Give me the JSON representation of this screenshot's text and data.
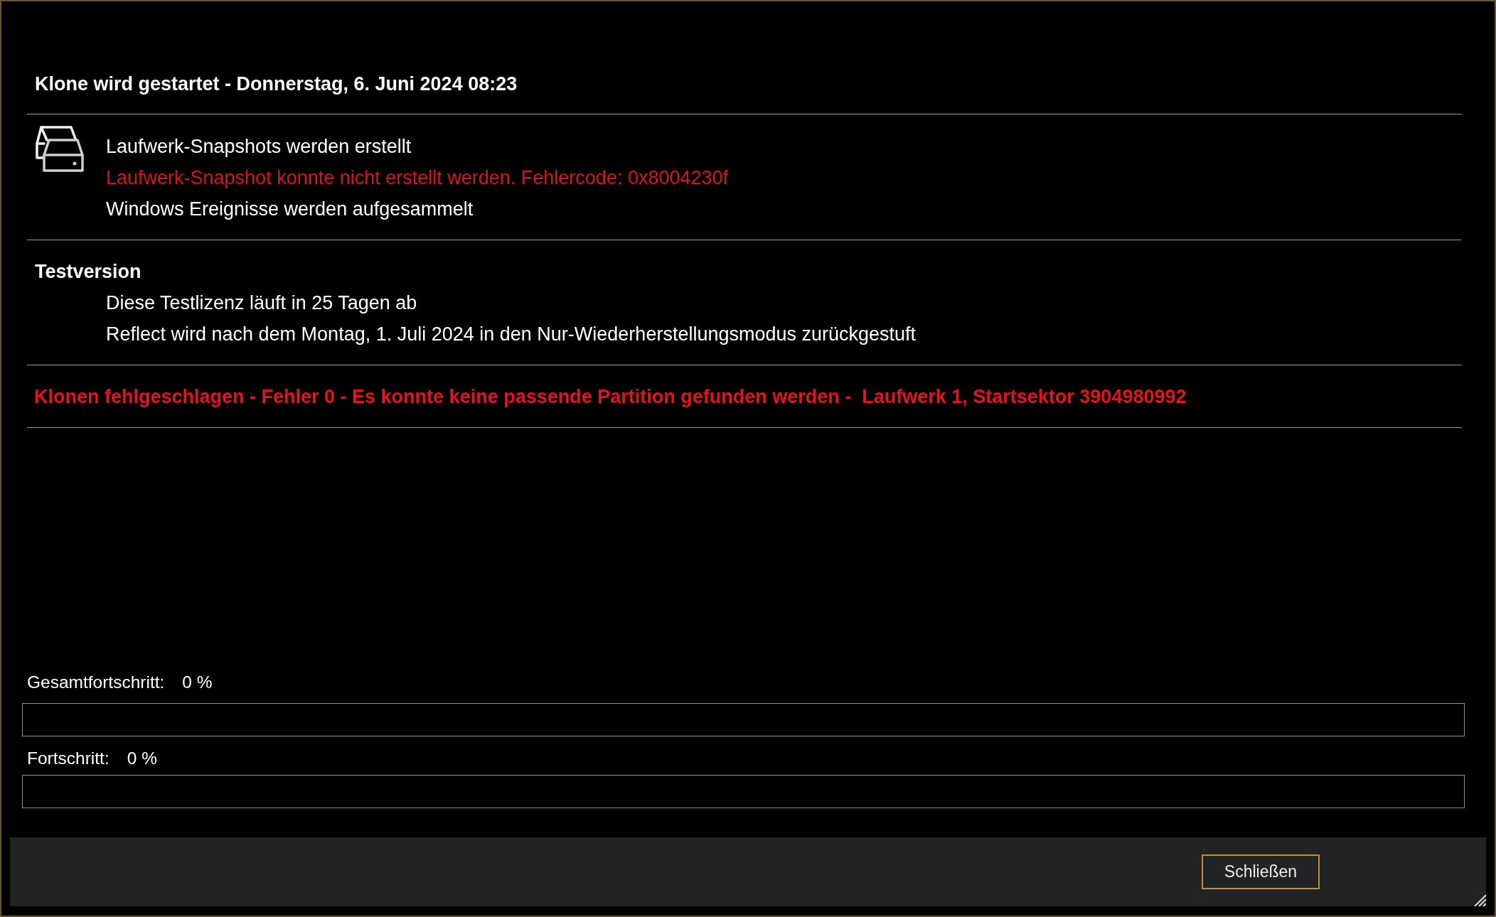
{
  "log": {
    "title": "Klone wird gestartet - Donnerstag, 6. Juni 2024 08:23",
    "sections": [
      {
        "kind": "steps",
        "lines": [
          {
            "text": "Laufwerk-Snapshots werden erstellt",
            "kind": "info"
          },
          {
            "text": "Laufwerk-Snapshot konnte nicht erstellt werden. Fehlercode: 0x8004230f",
            "kind": "error"
          },
          {
            "text": "Windows Ereignisse werden aufgesammelt",
            "kind": "info"
          }
        ]
      },
      {
        "kind": "notice",
        "title": "Testversion",
        "lines": [
          {
            "text": "Diese Testlizenz läuft in 25 Tagen ab",
            "kind": "info"
          },
          {
            "text": "Reflect wird nach dem Montag, 1. Juli 2024 in den Nur-Wiederherstellungsmodus zurückgestuft",
            "kind": "info"
          }
        ]
      },
      {
        "kind": "failure",
        "title": "Klonen fehlgeschlagen - Fehler 0 - Es konnte keine passende Partition gefunden werden -  Laufwerk 1, Startsektor 3904980992"
      }
    ]
  },
  "progress": [
    {
      "label": "Gesamtfortschritt:",
      "value": "0 %"
    },
    {
      "label": "Fortschritt:",
      "value": "0 %"
    }
  ],
  "footer": {
    "buttons": [
      {
        "label": "Schließen"
      }
    ]
  }
}
